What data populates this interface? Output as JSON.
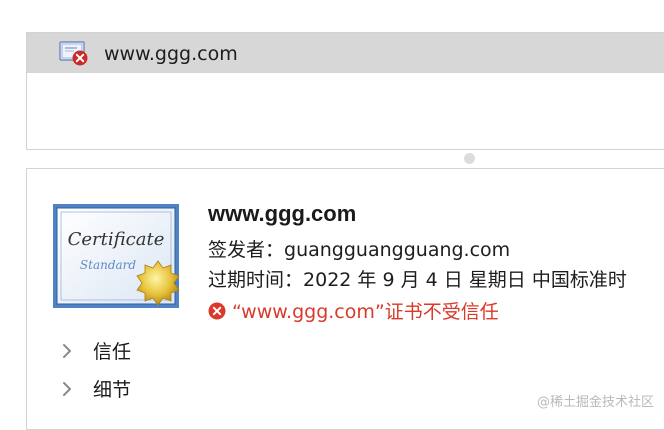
{
  "certificate_list": {
    "selected_item": "www.ggg.com"
  },
  "details": {
    "title": "www.ggg.com",
    "issuer_label": "签发者：",
    "issuer_value": "guangguangguang.com",
    "expiry_label": "过期时间：",
    "expiry_value": "2022 年 9 月 4 日 星期日 中国标准时",
    "status_text": "“www.ggg.com”证书不受信任",
    "certificate_art_text": [
      "Certificate",
      "Standard"
    ]
  },
  "sections": [
    {
      "label": "信任",
      "expanded": false
    },
    {
      "label": "细节",
      "expanded": false
    }
  ],
  "watermark": "@稀土掘金技术社区",
  "icons": {
    "list_item": "certificate-error-icon",
    "status": "error-circle-icon",
    "disclosure": "chevron-right-icon"
  },
  "colors": {
    "error": "#d93a2b",
    "selected_row": "#d7d7d7"
  }
}
